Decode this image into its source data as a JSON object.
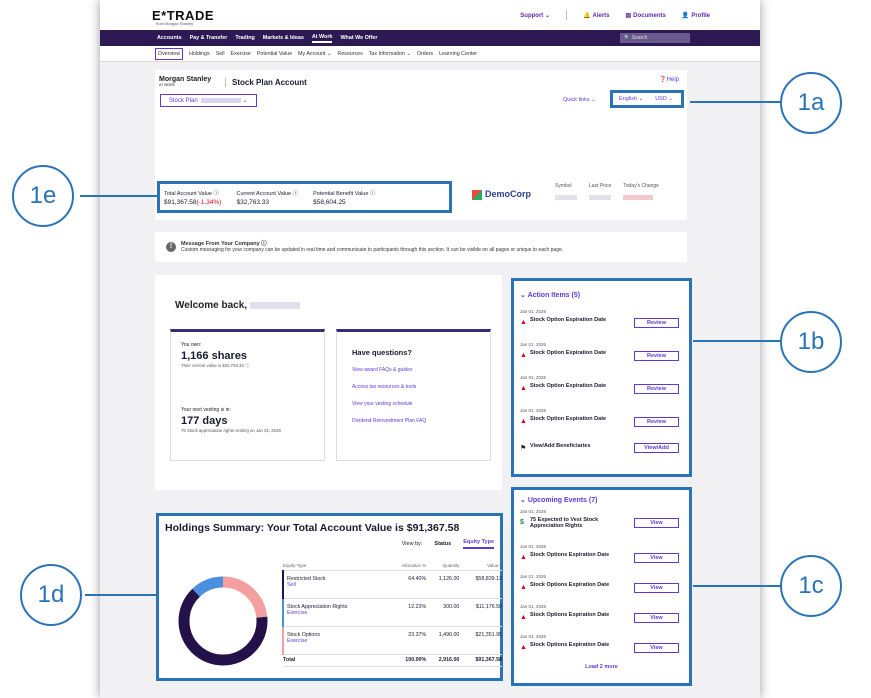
{
  "topbar": {
    "logo": "E*TRADE",
    "logo_sub": "from Morgan Stanley",
    "support": "Support ⌄",
    "alerts": "Alerts",
    "documents": "Documents",
    "profile": "Profile"
  },
  "mainnav": [
    "Accounts",
    "Pay & Transfer",
    "Trading",
    "Markets & Ideas",
    "At Work",
    "What We Offer"
  ],
  "search_placeholder": "Search",
  "subnav": [
    "Overview",
    "Holdings",
    "Sell",
    "Exercise",
    "Potential Value",
    "My Account ⌄",
    "Resources",
    "Tax Information ⌄",
    "Orders",
    "Learning Center"
  ],
  "header": {
    "ms_logo": "Morgan Stanley",
    "ms_sub": "AT WORK",
    "title": "Stock Plan Account",
    "plan": "Stock Plan",
    "help": "Help",
    "quick_links": "Quick links ⌄",
    "language": "English ⌄",
    "currency": "USD ⌄"
  },
  "values": {
    "total_label": "Total Account Value ⓘ",
    "total_value": "$91,367.58",
    "total_change": "(-1.34%)",
    "current_label": "Current Account Value ⓘ",
    "current_value": "$32,763.33",
    "potential_label": "Potential Benefit Value ⓘ",
    "potential_value": "$58,604.25"
  },
  "company": {
    "name": "DemoCorp",
    "symbol": "Symbol",
    "last_price": "Last Price",
    "todays_change": "Today's Change"
  },
  "message": {
    "title": "Message From Your Company ⓘ",
    "body": "Custom messaging for your company can be updated in real time and communicate to participants through this section. It can be visible on all pages or unique to each page."
  },
  "welcome": {
    "greeting": "Welcome back,",
    "you_own": "You own:",
    "shares": "1,166 shares",
    "current_value": "Their current value is $32,763.33 ⓘ",
    "next_vesting": "Your next vesting is in:",
    "days": "177 days",
    "vesting_note": "75 Stock appreciation rights vesting on Jan 01, 2026",
    "questions": "Have questions?",
    "links": [
      "View award FAQs & guides",
      "Access tax resources & tools",
      "View your vesting schedule",
      "Dividend Reinvestment Plan FAQ"
    ]
  },
  "action_items": {
    "title": "Action Items (5)",
    "items": [
      {
        "date": "Jan 01, 2026",
        "label": "Stock Option Expiration Date",
        "btn": "Review"
      },
      {
        "date": "Jan 01, 2026",
        "label": "Stock Option Expiration Date",
        "btn": "Review"
      },
      {
        "date": "Jan 01, 2026",
        "label": "Stock Option Expiration Date",
        "btn": "Review"
      },
      {
        "date": "Jan 01, 2026",
        "label": "Stock Option Expiration Date",
        "btn": "Review"
      }
    ],
    "beneficiaries": "View/Add Beneficiaries",
    "beneficiaries_btn": "View/Add"
  },
  "events": {
    "title": "Upcoming Events (7)",
    "items": [
      {
        "date": "Jan 01, 2026",
        "label": "75 Expected to Vest Stock Appreciation Rights",
        "btn": "View"
      },
      {
        "date": "Jan 01, 2026",
        "label": "Stock Options Expiration Date",
        "btn": "View"
      },
      {
        "date": "Jan 01, 2026",
        "label": "Stock Options Expiration Date",
        "btn": "View"
      },
      {
        "date": "Jan 01, 2026",
        "label": "Stock Options Expiration Date",
        "btn": "View"
      },
      {
        "date": "Jan 01, 2026",
        "label": "Stock Options Expiration Date",
        "btn": "View"
      }
    ],
    "load_more": "Load 2 more"
  },
  "holdings": {
    "title": "Holdings Summary: Your Total Account Value is $91,367.58",
    "view_by": "View by:",
    "status": "Status",
    "equity_type": "Equity Type",
    "headers": [
      "Equity Type",
      "Allocation %",
      "Quantity",
      "Value $"
    ],
    "rows": [
      {
        "name": "Restricted Stock",
        "action": "Sell",
        "alloc": "64.40%",
        "qty": "1,126.00",
        "value": "$58,839.13",
        "color": "#23124a",
        "pct": 64.4
      },
      {
        "name": "Stock Appreciation Rights",
        "action": "Exercise",
        "alloc": "12.23%",
        "qty": "300.00",
        "value": "$11,176.50",
        "color": "#4a8fe0",
        "pct": 12.23
      },
      {
        "name": "Stock Options",
        "action": "Exercise",
        "alloc": "23.37%",
        "qty": "1,490.00",
        "value": "$21,351.95",
        "color": "#f5a0a0",
        "pct": 23.37
      }
    ],
    "total": {
      "label": "Total",
      "alloc": "100.00%",
      "qty": "2,916.00",
      "value": "$91,367.58"
    }
  },
  "callouts": [
    "1a",
    "1b",
    "1c",
    "1d",
    "1e"
  ]
}
